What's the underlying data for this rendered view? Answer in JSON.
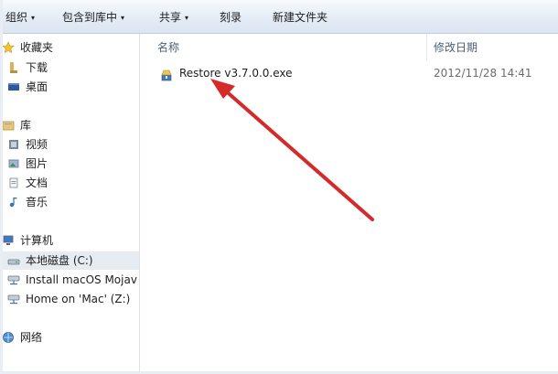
{
  "toolbar": {
    "organize": "组织",
    "include_library": "包含到库中",
    "share": "共享",
    "burn": "刻录",
    "new_folder": "新建文件夹"
  },
  "nav": {
    "favorites": "收藏夹",
    "downloads": "下载",
    "desktop": "桌面",
    "libraries": "库",
    "videos": "视频",
    "pictures": "图片",
    "documents": "文档",
    "music": "音乐",
    "computer": "计算机",
    "local_disk": "本地磁盘 (C:)",
    "install_macos": "Install macOS Mojav",
    "home_on_mac": "Home on 'Mac' (Z:)",
    "network": "网络"
  },
  "columns": {
    "name": "名称",
    "date_modified": "修改日期"
  },
  "files": [
    {
      "name": "Restore v3.7.0.0.exe",
      "date": "2012/11/28 14:41"
    }
  ],
  "colors": {
    "toolbar_top": "#f7fafd",
    "toolbar_bottom": "#dbe5f1",
    "selected_bg": "#e7ecf2",
    "arrow": "#d42a2a",
    "header_text": "#4c607a"
  },
  "icons": {
    "favorites": "star-icon",
    "downloads": "folder-download-icon",
    "desktop": "desktop-icon",
    "libraries": "library-icon",
    "computer": "computer-icon",
    "local_disk": "drive-icon",
    "network": "network-icon",
    "exe": "installer-icon"
  }
}
